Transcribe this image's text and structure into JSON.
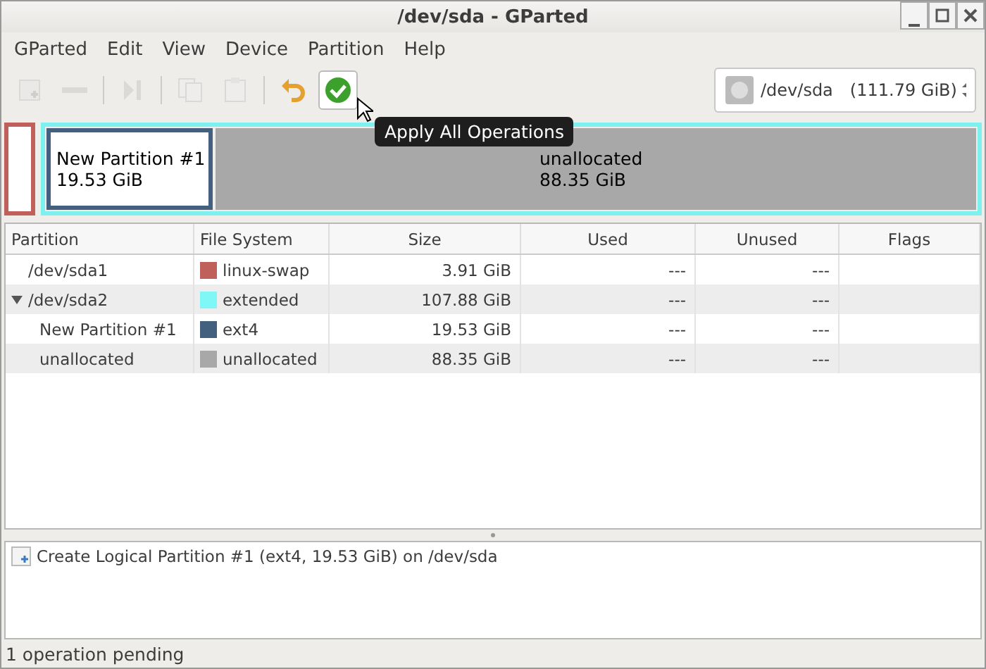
{
  "window": {
    "title": "/dev/sda - GParted"
  },
  "menu": [
    "GParted",
    "Edit",
    "View",
    "Device",
    "Partition",
    "Help"
  ],
  "toolbar": [
    {
      "kind": "new",
      "disabled": true
    },
    {
      "kind": "delete",
      "disabled": true
    },
    {
      "kind": "sep"
    },
    {
      "kind": "resize",
      "disabled": true
    },
    {
      "kind": "sep"
    },
    {
      "kind": "copy",
      "disabled": true
    },
    {
      "kind": "paste",
      "disabled": true
    },
    {
      "kind": "sep"
    },
    {
      "kind": "undo",
      "disabled": false
    },
    {
      "kind": "apply",
      "disabled": false,
      "hovered": true
    }
  ],
  "tooltip": "Apply All Operations",
  "device": {
    "path": "/dev/sda",
    "size": "(111.79 GiB)"
  },
  "disk_map": [
    {
      "kind": "swap",
      "color": "#c0605a"
    },
    {
      "kind": "extended",
      "color": "#7ff0f0",
      "children": [
        {
          "label": "New Partition #1",
          "size": "19.53 GiB",
          "color": "#44607f",
          "selected": true
        },
        {
          "label": "unallocated",
          "size": "88.35 GiB",
          "color": "#a8a8a8",
          "selected": false
        }
      ]
    }
  ],
  "table": {
    "columns": [
      "Partition",
      "File System",
      "Size",
      "Used",
      "Unused",
      "Flags"
    ],
    "rows": [
      {
        "partition": "/dev/sda1",
        "filesystem": "linux-swap",
        "color": "#c0605a",
        "size": "3.91 GiB",
        "used": "---",
        "unused": "---"
      },
      {
        "partition": "/dev/sda2",
        "filesystem": "extended",
        "color": "#7ff7f7",
        "size": "107.88 GiB",
        "used": "---",
        "unused": "---",
        "expanded": true,
        "children": [
          {
            "partition": "New Partition #1",
            "filesystem": "ext4",
            "color": "#44607f",
            "size": "19.53 GiB",
            "used": "---",
            "unused": "---"
          },
          {
            "partition": "unallocated",
            "filesystem": "unallocated",
            "color": "#a8a8a8",
            "size": "88.35 GiB",
            "used": "---",
            "unused": "---"
          }
        ]
      }
    ]
  },
  "operations": [
    "Create Logical Partition #1 (ext4, 19.53 GiB) on /dev/sda"
  ],
  "status_bar": "1 operation pending"
}
